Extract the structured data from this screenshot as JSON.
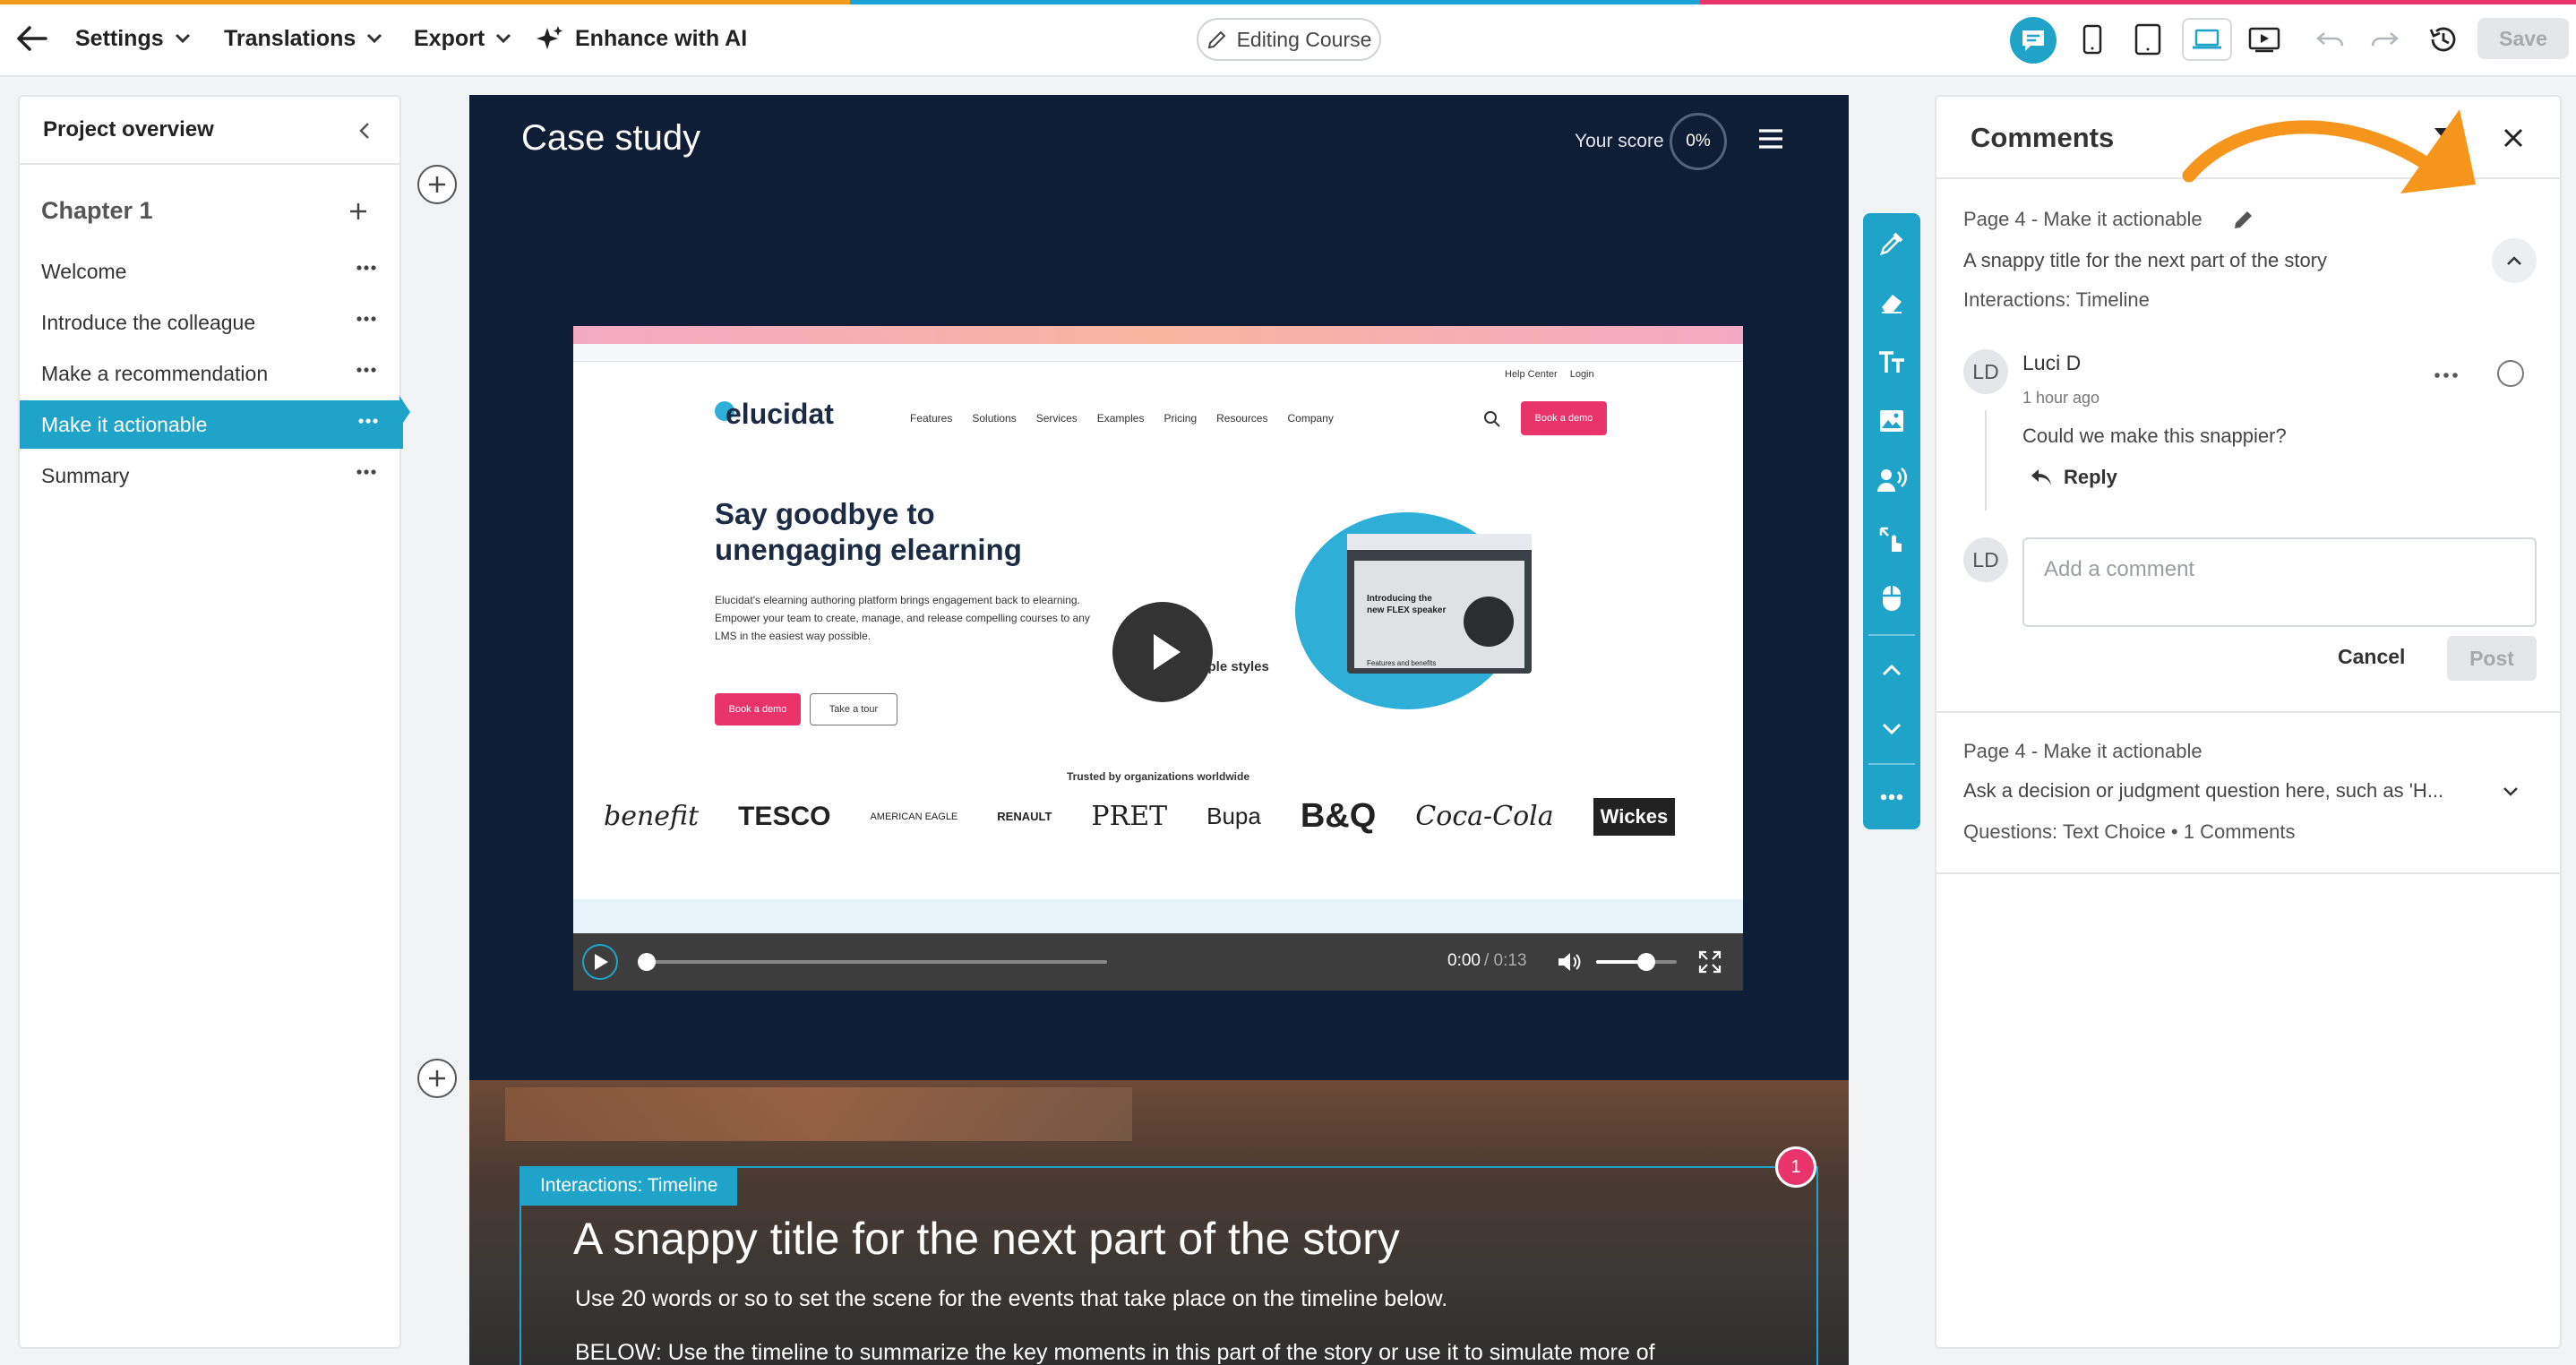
{
  "topbar": {
    "settings": "Settings",
    "translations": "Translations",
    "export": "Export",
    "enhance": "Enhance with AI",
    "mode": "Editing Course",
    "save": "Save"
  },
  "left_panel": {
    "title": "Project overview",
    "chapter": "Chapter 1",
    "pages": [
      {
        "label": "Welcome"
      },
      {
        "label": "Introduce the colleague"
      },
      {
        "label": "Make a recommendation"
      },
      {
        "label": "Make it actionable"
      },
      {
        "label": "Summary"
      }
    ],
    "active_index": 3
  },
  "canvas": {
    "title": "Case study",
    "score_label": "Your score",
    "score_value": "0%",
    "video": {
      "time_current": "0:00",
      "time_total": "/ 0:13",
      "volume": 0.6,
      "site": {
        "logo": "elucidat",
        "nav": [
          "Features",
          "Solutions",
          "Services",
          "Examples",
          "Pricing",
          "Resources",
          "Company"
        ],
        "cta": "Book a demo",
        "topright": [
          "Help Center",
          "Login"
        ],
        "headline1": "Say goodbye to",
        "headline2": "unengaging elearning",
        "body1": "Elucidat's elearning authoring platform brings engagement back to elearning.",
        "body2": "Empower your team to create, manage, and release compelling courses to any",
        "body3": "LMS in the easiest way possible.",
        "btn1": "Book a demo",
        "btn2": "Take a tour",
        "side_text": "ultiple styles",
        "promo1": "Introducing the",
        "promo2": "new FLEX speaker",
        "promo3": "Features and benefits",
        "trusted": "Trusted by organizations worldwide",
        "brands": [
          "benefit",
          "TESCO",
          "AMERICAN EAGLE",
          "RENAULT",
          "PRET",
          "Bupa",
          "B&Q",
          "Coca-Cola",
          "Wickes"
        ]
      }
    },
    "interaction_tag": "Interactions: Timeline",
    "badge": "1",
    "section_title": "A snappy title for the next part of the story",
    "section_body": "Use 20 words or so to set the scene for the events that take place on the timeline below.",
    "section_body2": "BELOW: Use the timeline to summarize the key moments in this part of the story or use it to simulate more of"
  },
  "comments": {
    "title": "Comments",
    "thread1": {
      "page": "Page 4 - Make it actionable",
      "subject": "A snappy title for the next part of the story",
      "type": "Interactions: Timeline",
      "author": "Luci D",
      "initials": "LD",
      "time": "1 hour ago",
      "text": "Could we make this snappier?",
      "reply": "Reply",
      "placeholder": "Add a comment",
      "cancel": "Cancel",
      "post": "Post"
    },
    "thread2": {
      "page": "Page 4 - Make it actionable",
      "subject": "Ask a decision or judgment question here, such as 'H...",
      "meta": "Questions: Text Choice • 1 Comments"
    }
  },
  "colors": {
    "accent": "#1fa3c9",
    "canvas_bg": "#0f1e37",
    "annotation": "#f5951b",
    "badge": "#e8336b"
  }
}
